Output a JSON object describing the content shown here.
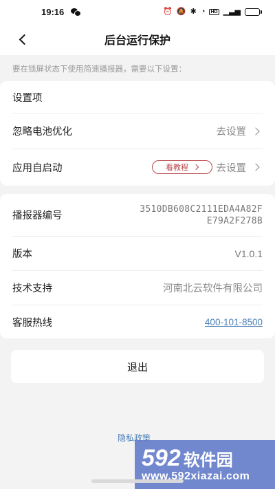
{
  "status_bar": {
    "time": "19:16",
    "icons": [
      "wechat-icon",
      "alarm-icon",
      "mute-icon",
      "bluetooth-icon",
      "wifi-icon",
      "hd-icon",
      "signal-icon",
      "battery-icon"
    ],
    "hd_label": "HD",
    "battery_level": 0.85
  },
  "header": {
    "title": "后台运行保护",
    "back_icon": "chevron-left-icon"
  },
  "hint": "要在锁屏状态下使用简速播报器，需要以下设置：",
  "settings": {
    "section_title": "设置项",
    "items": [
      {
        "label": "忽略电池优化",
        "action": "去设置"
      },
      {
        "label": "应用自启动",
        "tutorial": "看教程",
        "action": "去设置"
      }
    ]
  },
  "info": {
    "device_id_label": "播报器编号",
    "device_id_line1": "3510DB608C2111EDA4A82F",
    "device_id_line2": "E79A2F278B",
    "version_label": "版本",
    "version_value": "V1.0.1",
    "support_label": "技术支持",
    "support_value": "河南北云软件有限公司",
    "hotline_label": "客服热线",
    "hotline_value": "400-101-8500"
  },
  "logout_label": "退出",
  "privacy_label": "隐私政策",
  "watermark": {
    "num": "592",
    "cn": "软件园",
    "url": "www.592xiazai.com"
  },
  "colors": {
    "accent_link": "#4a7fb8",
    "tutorial": "#b8474c",
    "background": "#f3f3f4"
  }
}
